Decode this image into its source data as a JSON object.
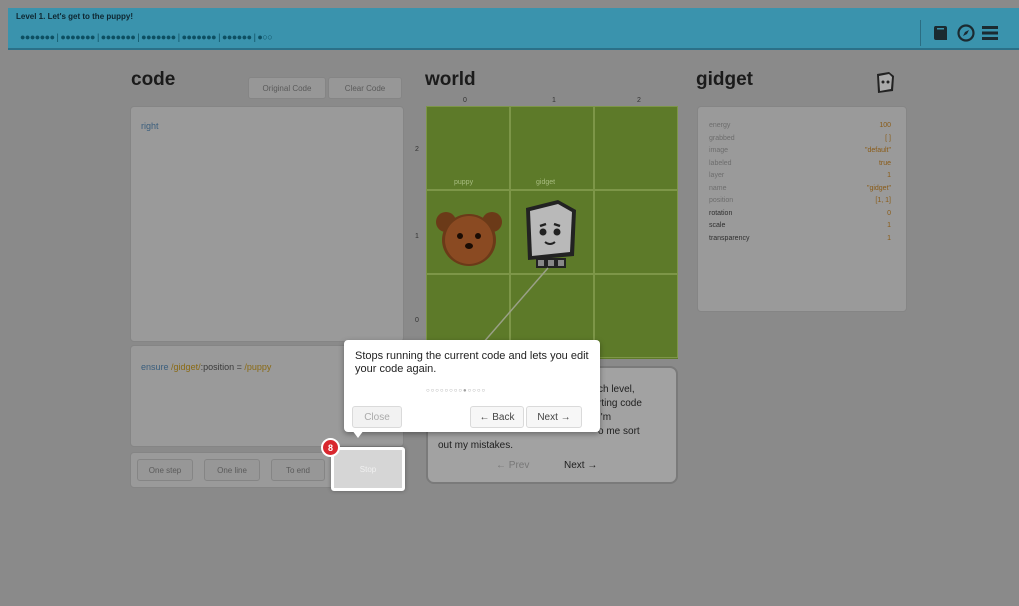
{
  "header": {
    "level_title": "Level 1. Let's get to the puppy!",
    "progress": "●●●●●●● | ●●●●●●● | ●●●●●●● | ●●●●●●● | ●●●●●●● | ●●●●●● | ●○○",
    "icons": [
      "book-icon",
      "compass-icon",
      "menu-icon"
    ]
  },
  "code": {
    "title": "code",
    "original_code_label": "Original Code",
    "clear_code_label": "Clear Code",
    "editor_text": "right",
    "ensure_keyword": "ensure",
    "ensure_gidget": "/gidget/",
    "ensure_position": ":position = ",
    "ensure_puppy": "/puppy",
    "controls": {
      "one_step": "One step",
      "one_line": "One line",
      "to_end": "To end",
      "stop": "Stop"
    }
  },
  "world": {
    "title": "world",
    "x_axis": [
      "0",
      "1",
      "2"
    ],
    "y_axis": [
      "2",
      "1",
      "0"
    ],
    "labels": {
      "puppy": "puppy",
      "gidget": "gidget"
    }
  },
  "gidget": {
    "title": "gidget",
    "properties": [
      {
        "key": "energy",
        "value": "100"
      },
      {
        "key": "grabbed",
        "value": "[ ]"
      },
      {
        "key": "image",
        "value": "\"default\""
      },
      {
        "key": "labeled",
        "value": "true"
      },
      {
        "key": "layer",
        "value": "1"
      },
      {
        "key": "name",
        "value": "\"gidget\""
      },
      {
        "key": "position",
        "value": "[1, 1]"
      },
      {
        "key": "rotation",
        "value": "0"
      },
      {
        "key": "scale",
        "value": "1"
      },
      {
        "key": "transparency",
        "value": "1"
      }
    ]
  },
  "popup": {
    "message": "Stops running the current code and lets you edit your code again.",
    "dots": "○○○○○○○○●○○○○",
    "close_label": "Close",
    "back_label": "← Back",
    "next_label": "Next →"
  },
  "speech": {
    "lines": [
      "ch level,",
      "rting code",
      "I'm",
      "o me sort",
      "out my mistakes."
    ],
    "prev_label": "← Prev",
    "next_label": "Next →"
  },
  "badge": "8",
  "colors": {
    "header_bg": "#3a93ad",
    "grass": "#5d7a29",
    "badge": "#d9272e"
  }
}
